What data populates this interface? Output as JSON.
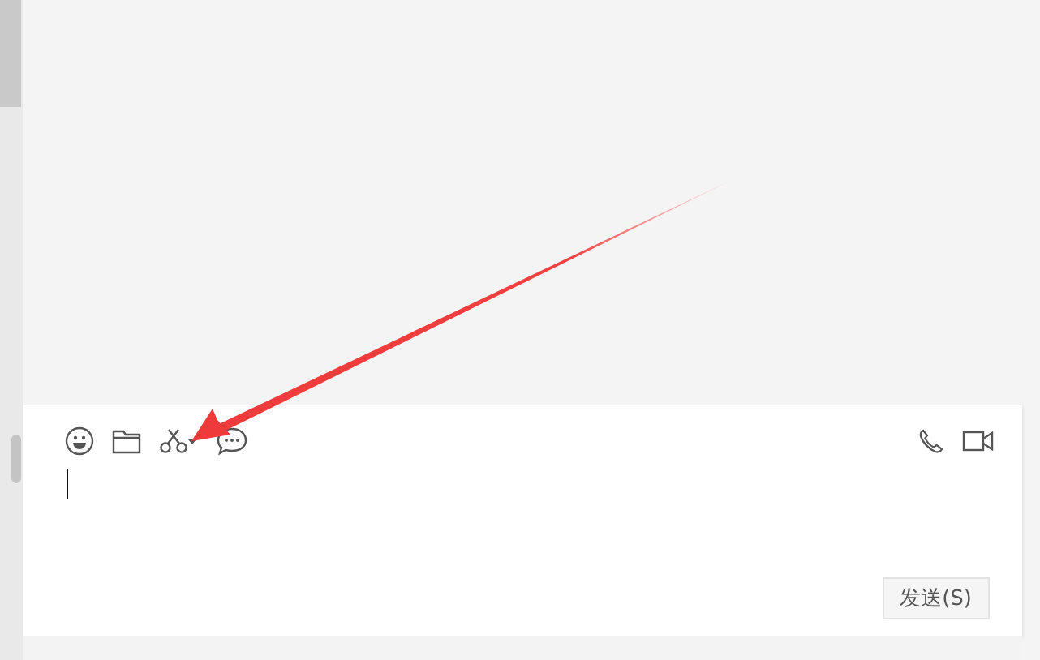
{
  "composer": {
    "send_button": {
      "label": "发送(S)"
    }
  }
}
